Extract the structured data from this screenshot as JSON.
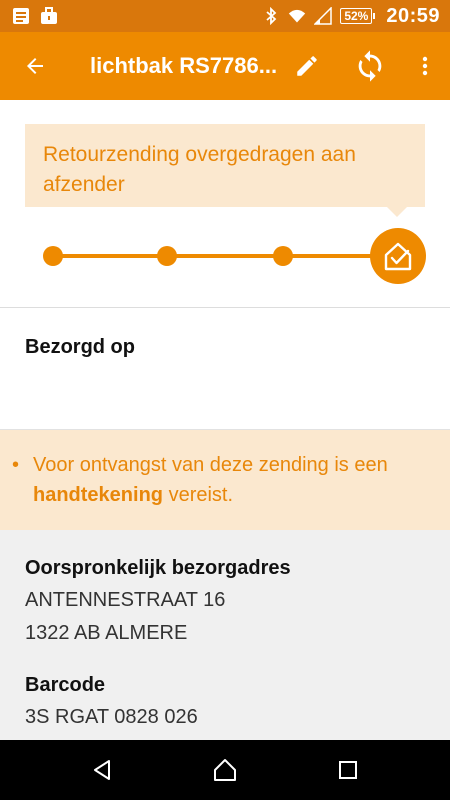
{
  "status_bar": {
    "time": "20:59",
    "battery": "52%",
    "icons": [
      "document-icon",
      "briefcase-icon",
      "bluetooth-icon",
      "wifi-icon",
      "signal-icon",
      "battery-icon"
    ]
  },
  "app_bar": {
    "title": "lichtbak RS7786...",
    "back_icon": "arrow-left-icon",
    "actions": [
      "edit-icon",
      "refresh-icon",
      "more-vert-icon"
    ]
  },
  "status_card": {
    "message": "Retourzending overgedragen aan afzender"
  },
  "progress": {
    "steps_total": 4,
    "steps_completed": 4,
    "final_icon": "home-check-icon"
  },
  "delivered": {
    "label": "Bezorgd op"
  },
  "notice": {
    "bullet": "•",
    "text_before": "Voor ontvangst van deze zending is een ",
    "text_bold": "handtekening",
    "text_after": " vereist."
  },
  "details": {
    "original_address_label": "Oorspronkelijk bezorgadres",
    "address_line1": "ANTENNESTRAAT 16",
    "address_line2": "1322 AB ALMERE",
    "barcode_label": "Barcode",
    "barcode_value": "3S RGAT 0828 026"
  },
  "nav_bar": {
    "buttons": [
      "back-triangle-icon",
      "home-icon",
      "recents-icon"
    ]
  },
  "colors": {
    "status_bar": "#d9770c",
    "app_bar": "#ee8a00",
    "accent": "#ee8a00",
    "light_accent": "#fbe8cf",
    "text_accent": "#e8870a"
  }
}
